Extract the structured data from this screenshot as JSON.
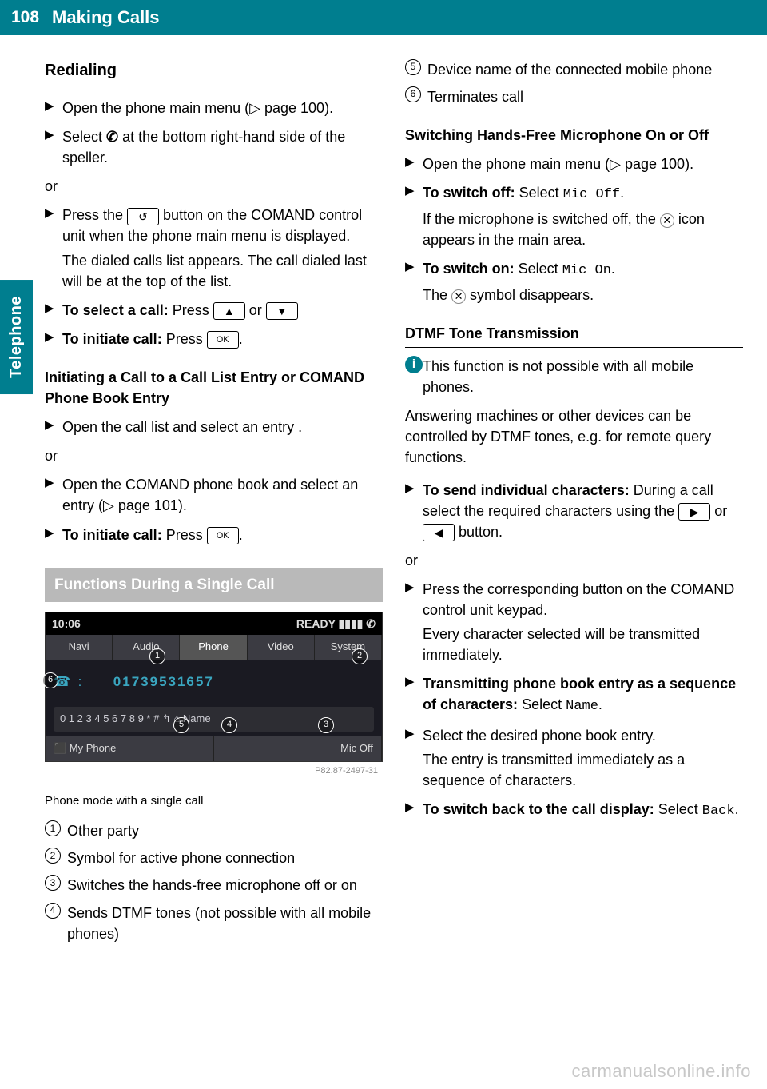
{
  "page_number": "108",
  "header_title": "Making Calls",
  "side_tab": "Telephone",
  "col1": {
    "h_redialing": "Redialing",
    "s1": "Open the phone main menu (▷ page 100).",
    "s2a": "Select ",
    "s2b": " at the bottom right-hand side of the speller.",
    "or1": "or",
    "s3a": "Press the ",
    "s3b": " button on the COMAND control unit when the phone main menu is displayed.",
    "s3c": "The dialed calls list appears. The call dialed last will be at the top of the list.",
    "s4a": "To select a call: ",
    "s4b": "Press ",
    "s4c": " or ",
    "s5a": "To initiate call: ",
    "s5b": "Press ",
    "key_up": "▲",
    "key_down": "▼",
    "key_ok": "OK",
    "key_phone": "↺",
    "h_initiating": "Initiating a Call to a Call List Entry or COMAND Phone Book Entry",
    "s6": "Open the call list and select an entry .",
    "or2": "or",
    "s7": "Open the COMAND phone book and select an entry (▷ page 101).",
    "s8a": "To initiate call: ",
    "s8b": "Press ",
    "h_functions": "Functions During a Single Call",
    "fig": {
      "time": "10:06",
      "ready": "READY ▮▮▮▮ ✆",
      "tabs": [
        "Navi",
        "Audio",
        "Phone",
        "Video",
        "System"
      ],
      "number": "01739531657",
      "digits": "0 1 2 3 4 5 6 7 8 9 * # ↰ ⌂ Name",
      "bottom": [
        "⬛ My Phone",
        "Mic Off"
      ],
      "id": "P82.87-2497-31"
    },
    "caption": "Phone mode with a single call",
    "legend": {
      "l1": "Other party",
      "l2": "Symbol for active phone connection",
      "l3": "Switches the hands-free microphone off or on",
      "l4": "Sends DTMF tones (not possible with all mobile phones)"
    }
  },
  "col2": {
    "legend": {
      "l5": "Device name of the connected mobile phone",
      "l6": "Terminates call"
    },
    "h_switching": "Switching Hands-Free Microphone On or Off",
    "s1": "Open the phone main menu (▷ page 100).",
    "s2a": "To switch off: ",
    "s2b": "Select ",
    "s2c": "Mic Off",
    "s2d": ".",
    "s2e": "If the microphone is switched off, the ",
    "s2f": " icon appears in the main area.",
    "s3a": "To switch on: ",
    "s3b": "Select ",
    "s3c": "Mic On",
    "s3d": ".",
    "s3e": "The ",
    "s3f": " symbol disappears.",
    "h_dtmf": "DTMF Tone Transmission",
    "info": "This function is not possible with all mobile phones.",
    "para": "Answering machines or other devices can be controlled by DTMF tones, e.g. for remote query functions.",
    "s4a": "To send individual characters: ",
    "s4b": "During a call select the required characters using the ",
    "s4c": " or ",
    "s4d": " button.",
    "key_right": "▶",
    "key_left": "◀",
    "or1": "or",
    "s5": "Press the corresponding button on the COMAND control unit keypad.",
    "s5b": "Every character selected will be transmitted immediately.",
    "s6a": "Transmitting phone book entry as a sequence of characters: ",
    "s6b": "Select ",
    "s6c": "Name",
    "s6d": ".",
    "s7a": "Select the desired phone book entry.",
    "s7b": "The entry is transmitted immediately as a sequence of characters.",
    "s8a": "To switch back to the call display: ",
    "s8b": "Select ",
    "s8c": "Back",
    "s8d": "."
  },
  "watermark": "carmanualsonline.info"
}
